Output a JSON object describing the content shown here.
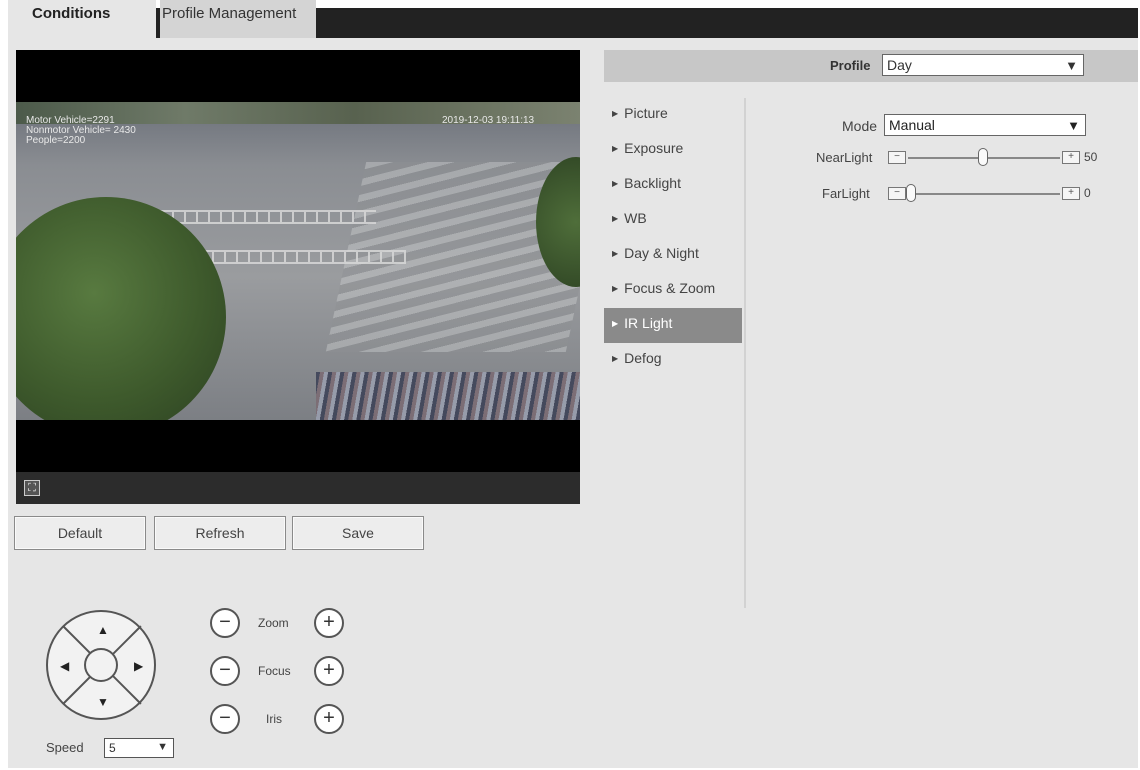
{
  "tabs": {
    "conditions": "Conditions",
    "profile_management": "Profile Management"
  },
  "video": {
    "osd_lines": [
      "Motor Vehicle=2291",
      "Nonmotor Vehicle= 2430",
      "People=2200"
    ],
    "osd_time": "2019-12-03 19:11:13",
    "fullscreen_icon": "fullscreen-icon"
  },
  "actions": {
    "default": "Default",
    "refresh": "Refresh",
    "save": "Save"
  },
  "ptz": {
    "zoom": "Zoom",
    "focus": "Focus",
    "iris": "Iris",
    "minus": "−",
    "plus": "+",
    "speed_label": "Speed",
    "speed_value": "5"
  },
  "profile": {
    "label": "Profile",
    "value": "Day"
  },
  "menu": [
    "Picture",
    "Exposure",
    "Backlight",
    "WB",
    "Day & Night",
    "Focus & Zoom",
    "IR Light",
    "Defog"
  ],
  "menu_active": "IR Light",
  "ir": {
    "mode_label": "Mode",
    "mode_value": "Manual",
    "near_label": "NearLight",
    "near_value": "50",
    "far_label": "FarLight",
    "far_value": "0"
  }
}
